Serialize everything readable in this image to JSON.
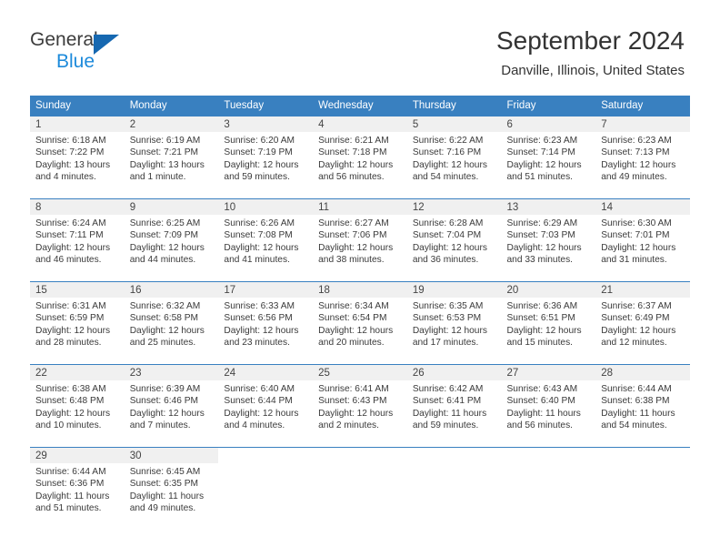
{
  "brand": {
    "line1": "General",
    "line2": "Blue",
    "triangle_color": "#1668b1",
    "blue_text_color": "#1c8adb"
  },
  "header": {
    "title": "September 2024",
    "subtitle": "Danville, Illinois, United States",
    "header_bg": "#3980c0",
    "day_band_bg": "#f0f0f0"
  },
  "weekday_headers": [
    "Sunday",
    "Monday",
    "Tuesday",
    "Wednesday",
    "Thursday",
    "Friday",
    "Saturday"
  ],
  "labels": {
    "sunrise_prefix": "Sunrise: ",
    "sunset_prefix": "Sunset: ",
    "daylight_prefix": "Daylight: "
  },
  "weeks": [
    [
      {
        "day": "1",
        "sunrise": "Sunrise: 6:18 AM",
        "sunset": "Sunset: 7:22 PM",
        "daylight_line1": "Daylight: 13 hours",
        "daylight_line2": "and 4 minutes."
      },
      {
        "day": "2",
        "sunrise": "Sunrise: 6:19 AM",
        "sunset": "Sunset: 7:21 PM",
        "daylight_line1": "Daylight: 13 hours",
        "daylight_line2": "and 1 minute."
      },
      {
        "day": "3",
        "sunrise": "Sunrise: 6:20 AM",
        "sunset": "Sunset: 7:19 PM",
        "daylight_line1": "Daylight: 12 hours",
        "daylight_line2": "and 59 minutes."
      },
      {
        "day": "4",
        "sunrise": "Sunrise: 6:21 AM",
        "sunset": "Sunset: 7:18 PM",
        "daylight_line1": "Daylight: 12 hours",
        "daylight_line2": "and 56 minutes."
      },
      {
        "day": "5",
        "sunrise": "Sunrise: 6:22 AM",
        "sunset": "Sunset: 7:16 PM",
        "daylight_line1": "Daylight: 12 hours",
        "daylight_line2": "and 54 minutes."
      },
      {
        "day": "6",
        "sunrise": "Sunrise: 6:23 AM",
        "sunset": "Sunset: 7:14 PM",
        "daylight_line1": "Daylight: 12 hours",
        "daylight_line2": "and 51 minutes."
      },
      {
        "day": "7",
        "sunrise": "Sunrise: 6:23 AM",
        "sunset": "Sunset: 7:13 PM",
        "daylight_line1": "Daylight: 12 hours",
        "daylight_line2": "and 49 minutes."
      }
    ],
    [
      {
        "day": "8",
        "sunrise": "Sunrise: 6:24 AM",
        "sunset": "Sunset: 7:11 PM",
        "daylight_line1": "Daylight: 12 hours",
        "daylight_line2": "and 46 minutes."
      },
      {
        "day": "9",
        "sunrise": "Sunrise: 6:25 AM",
        "sunset": "Sunset: 7:09 PM",
        "daylight_line1": "Daylight: 12 hours",
        "daylight_line2": "and 44 minutes."
      },
      {
        "day": "10",
        "sunrise": "Sunrise: 6:26 AM",
        "sunset": "Sunset: 7:08 PM",
        "daylight_line1": "Daylight: 12 hours",
        "daylight_line2": "and 41 minutes."
      },
      {
        "day": "11",
        "sunrise": "Sunrise: 6:27 AM",
        "sunset": "Sunset: 7:06 PM",
        "daylight_line1": "Daylight: 12 hours",
        "daylight_line2": "and 38 minutes."
      },
      {
        "day": "12",
        "sunrise": "Sunrise: 6:28 AM",
        "sunset": "Sunset: 7:04 PM",
        "daylight_line1": "Daylight: 12 hours",
        "daylight_line2": "and 36 minutes."
      },
      {
        "day": "13",
        "sunrise": "Sunrise: 6:29 AM",
        "sunset": "Sunset: 7:03 PM",
        "daylight_line1": "Daylight: 12 hours",
        "daylight_line2": "and 33 minutes."
      },
      {
        "day": "14",
        "sunrise": "Sunrise: 6:30 AM",
        "sunset": "Sunset: 7:01 PM",
        "daylight_line1": "Daylight: 12 hours",
        "daylight_line2": "and 31 minutes."
      }
    ],
    [
      {
        "day": "15",
        "sunrise": "Sunrise: 6:31 AM",
        "sunset": "Sunset: 6:59 PM",
        "daylight_line1": "Daylight: 12 hours",
        "daylight_line2": "and 28 minutes."
      },
      {
        "day": "16",
        "sunrise": "Sunrise: 6:32 AM",
        "sunset": "Sunset: 6:58 PM",
        "daylight_line1": "Daylight: 12 hours",
        "daylight_line2": "and 25 minutes."
      },
      {
        "day": "17",
        "sunrise": "Sunrise: 6:33 AM",
        "sunset": "Sunset: 6:56 PM",
        "daylight_line1": "Daylight: 12 hours",
        "daylight_line2": "and 23 minutes."
      },
      {
        "day": "18",
        "sunrise": "Sunrise: 6:34 AM",
        "sunset": "Sunset: 6:54 PM",
        "daylight_line1": "Daylight: 12 hours",
        "daylight_line2": "and 20 minutes."
      },
      {
        "day": "19",
        "sunrise": "Sunrise: 6:35 AM",
        "sunset": "Sunset: 6:53 PM",
        "daylight_line1": "Daylight: 12 hours",
        "daylight_line2": "and 17 minutes."
      },
      {
        "day": "20",
        "sunrise": "Sunrise: 6:36 AM",
        "sunset": "Sunset: 6:51 PM",
        "daylight_line1": "Daylight: 12 hours",
        "daylight_line2": "and 15 minutes."
      },
      {
        "day": "21",
        "sunrise": "Sunrise: 6:37 AM",
        "sunset": "Sunset: 6:49 PM",
        "daylight_line1": "Daylight: 12 hours",
        "daylight_line2": "and 12 minutes."
      }
    ],
    [
      {
        "day": "22",
        "sunrise": "Sunrise: 6:38 AM",
        "sunset": "Sunset: 6:48 PM",
        "daylight_line1": "Daylight: 12 hours",
        "daylight_line2": "and 10 minutes."
      },
      {
        "day": "23",
        "sunrise": "Sunrise: 6:39 AM",
        "sunset": "Sunset: 6:46 PM",
        "daylight_line1": "Daylight: 12 hours",
        "daylight_line2": "and 7 minutes."
      },
      {
        "day": "24",
        "sunrise": "Sunrise: 6:40 AM",
        "sunset": "Sunset: 6:44 PM",
        "daylight_line1": "Daylight: 12 hours",
        "daylight_line2": "and 4 minutes."
      },
      {
        "day": "25",
        "sunrise": "Sunrise: 6:41 AM",
        "sunset": "Sunset: 6:43 PM",
        "daylight_line1": "Daylight: 12 hours",
        "daylight_line2": "and 2 minutes."
      },
      {
        "day": "26",
        "sunrise": "Sunrise: 6:42 AM",
        "sunset": "Sunset: 6:41 PM",
        "daylight_line1": "Daylight: 11 hours",
        "daylight_line2": "and 59 minutes."
      },
      {
        "day": "27",
        "sunrise": "Sunrise: 6:43 AM",
        "sunset": "Sunset: 6:40 PM",
        "daylight_line1": "Daylight: 11 hours",
        "daylight_line2": "and 56 minutes."
      },
      {
        "day": "28",
        "sunrise": "Sunrise: 6:44 AM",
        "sunset": "Sunset: 6:38 PM",
        "daylight_line1": "Daylight: 11 hours",
        "daylight_line2": "and 54 minutes."
      }
    ],
    [
      {
        "day": "29",
        "sunrise": "Sunrise: 6:44 AM",
        "sunset": "Sunset: 6:36 PM",
        "daylight_line1": "Daylight: 11 hours",
        "daylight_line2": "and 51 minutes."
      },
      {
        "day": "30",
        "sunrise": "Sunrise: 6:45 AM",
        "sunset": "Sunset: 6:35 PM",
        "daylight_line1": "Daylight: 11 hours",
        "daylight_line2": "and 49 minutes."
      },
      {
        "day": "",
        "sunrise": "",
        "sunset": "",
        "daylight_line1": "",
        "daylight_line2": ""
      },
      {
        "day": "",
        "sunrise": "",
        "sunset": "",
        "daylight_line1": "",
        "daylight_line2": ""
      },
      {
        "day": "",
        "sunrise": "",
        "sunset": "",
        "daylight_line1": "",
        "daylight_line2": ""
      },
      {
        "day": "",
        "sunrise": "",
        "sunset": "",
        "daylight_line1": "",
        "daylight_line2": ""
      },
      {
        "day": "",
        "sunrise": "",
        "sunset": "",
        "daylight_line1": "",
        "daylight_line2": ""
      }
    ]
  ]
}
